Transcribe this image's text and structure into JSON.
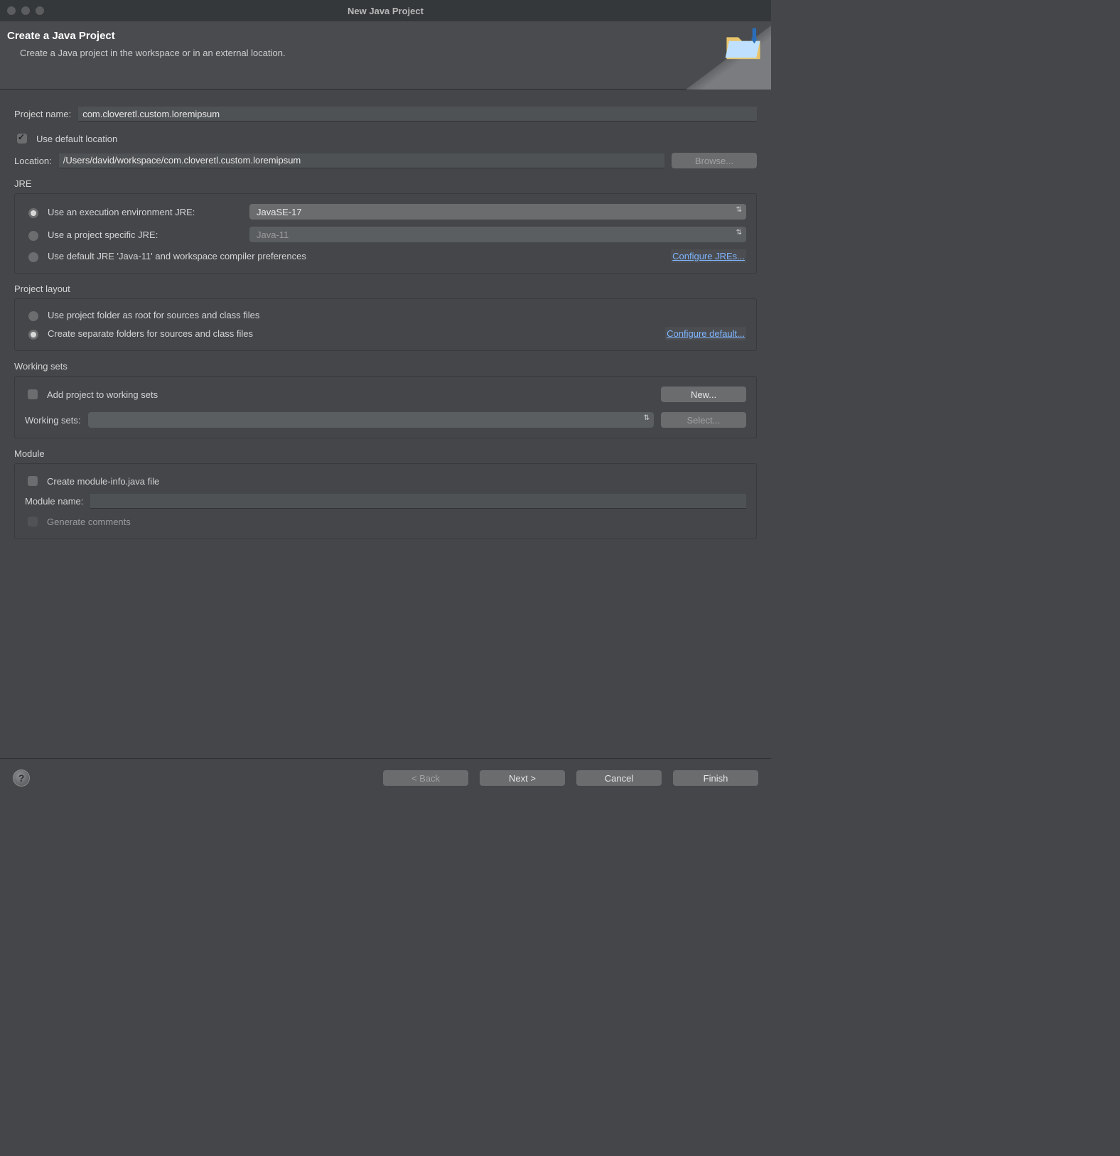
{
  "window_title": "New Java Project",
  "header": {
    "title": "Create a Java Project",
    "subtitle": "Create a Java project in the workspace or in an external location."
  },
  "name": {
    "label": "Project name:",
    "value": "com.cloveretl.custom.loremipsum"
  },
  "location": {
    "use_default_label": "Use default location",
    "label": "Location:",
    "value": "/Users/david/workspace/com.cloveretl.custom.loremipsum",
    "browse": "Browse..."
  },
  "jre": {
    "title": "JRE",
    "exec_env_label": "Use an execution environment JRE:",
    "exec_env_value": "JavaSE-17",
    "project_specific_label": "Use a project specific JRE:",
    "project_specific_value": "Java-11",
    "default_jre_label": "Use default JRE 'Java-11' and workspace compiler preferences",
    "configure_link": "Configure JREs..."
  },
  "layout": {
    "title": "Project layout",
    "opt_root": "Use project folder as root for sources and class files",
    "opt_split": "Create separate folders for sources and class files",
    "configure_link": "Configure default..."
  },
  "working_sets": {
    "title": "Working sets",
    "add_label": "Add project to working sets",
    "new_btn": "New...",
    "label": "Working sets:",
    "select_btn": "Select..."
  },
  "module": {
    "title": "Module",
    "create_label": "Create module-info.java file",
    "name_label": "Module name:",
    "gen_label": "Generate comments"
  },
  "footer": {
    "back": "< Back",
    "next": "Next >",
    "cancel": "Cancel",
    "finish": "Finish"
  }
}
